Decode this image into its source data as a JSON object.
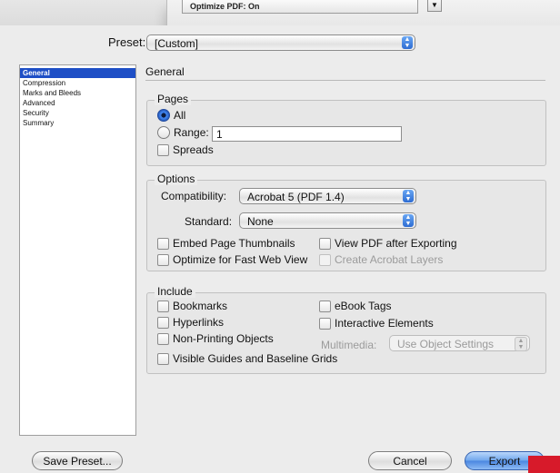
{
  "top_sheet": {
    "field_text": "Optimize PDF: On",
    "arrow": "▼"
  },
  "preset": {
    "label": "Preset:",
    "value": "[Custom]"
  },
  "sidebar": {
    "items": [
      {
        "label": "General",
        "selected": true
      },
      {
        "label": "Compression"
      },
      {
        "label": "Marks and Bleeds"
      },
      {
        "label": "Advanced"
      },
      {
        "label": "Security"
      },
      {
        "label": "Summary"
      }
    ]
  },
  "section_title": "General",
  "pages": {
    "title": "Pages",
    "all_label": "All",
    "range_label": "Range:",
    "range_value": "1",
    "spreads_label": "Spreads"
  },
  "options": {
    "title": "Options",
    "compatibility_label": "Compatibility:",
    "compatibility_value": "Acrobat 5 (PDF 1.4)",
    "standard_label": "Standard:",
    "standard_value": "None",
    "embed_thumbnails": "Embed Page Thumbnails",
    "view_pdf": "View PDF after Exporting",
    "optimize_web": "Optimize for Fast Web View",
    "create_layers": "Create Acrobat Layers"
  },
  "include": {
    "title": "Include",
    "bookmarks": "Bookmarks",
    "ebook_tags": "eBook Tags",
    "hyperlinks": "Hyperlinks",
    "interactive": "Interactive Elements",
    "nonprinting": "Non-Printing Objects",
    "multimedia_label": "Multimedia:",
    "multimedia_value": "Use Object Settings",
    "visible_guides": "Visible Guides and Baseline Grids"
  },
  "buttons": {
    "save_preset": "Save Preset...",
    "cancel": "Cancel",
    "export": "Export"
  }
}
